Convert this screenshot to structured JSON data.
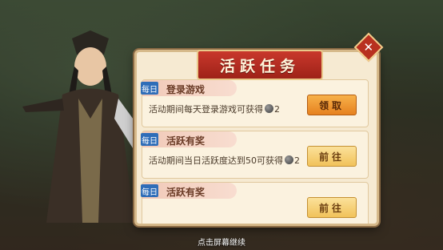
{
  "panel": {
    "title": "活跃任务"
  },
  "tasks": [
    {
      "tag": "每日",
      "name": "登录游戏",
      "desc": "活动期间每天登录游戏可获得",
      "reward": "2",
      "button": "领取",
      "button_state": "claim"
    },
    {
      "tag": "每日",
      "name": "活跃有奖",
      "desc": "活动期间当日活跃度达到50可获得",
      "reward": "2",
      "button": "前往",
      "button_state": "goto"
    },
    {
      "tag": "每日",
      "name": "活跃有奖",
      "desc": "",
      "reward": "",
      "button": "前往",
      "button_state": "goto"
    }
  ],
  "close_icon": "close-icon",
  "coin_icon": "coin-icon",
  "hint": "点击屏幕继续",
  "colors": {
    "title_plate": "#b8301f",
    "claim_button": "#f0952f",
    "goto_button": "#f6d27a",
    "tag": "#2f6db8"
  }
}
